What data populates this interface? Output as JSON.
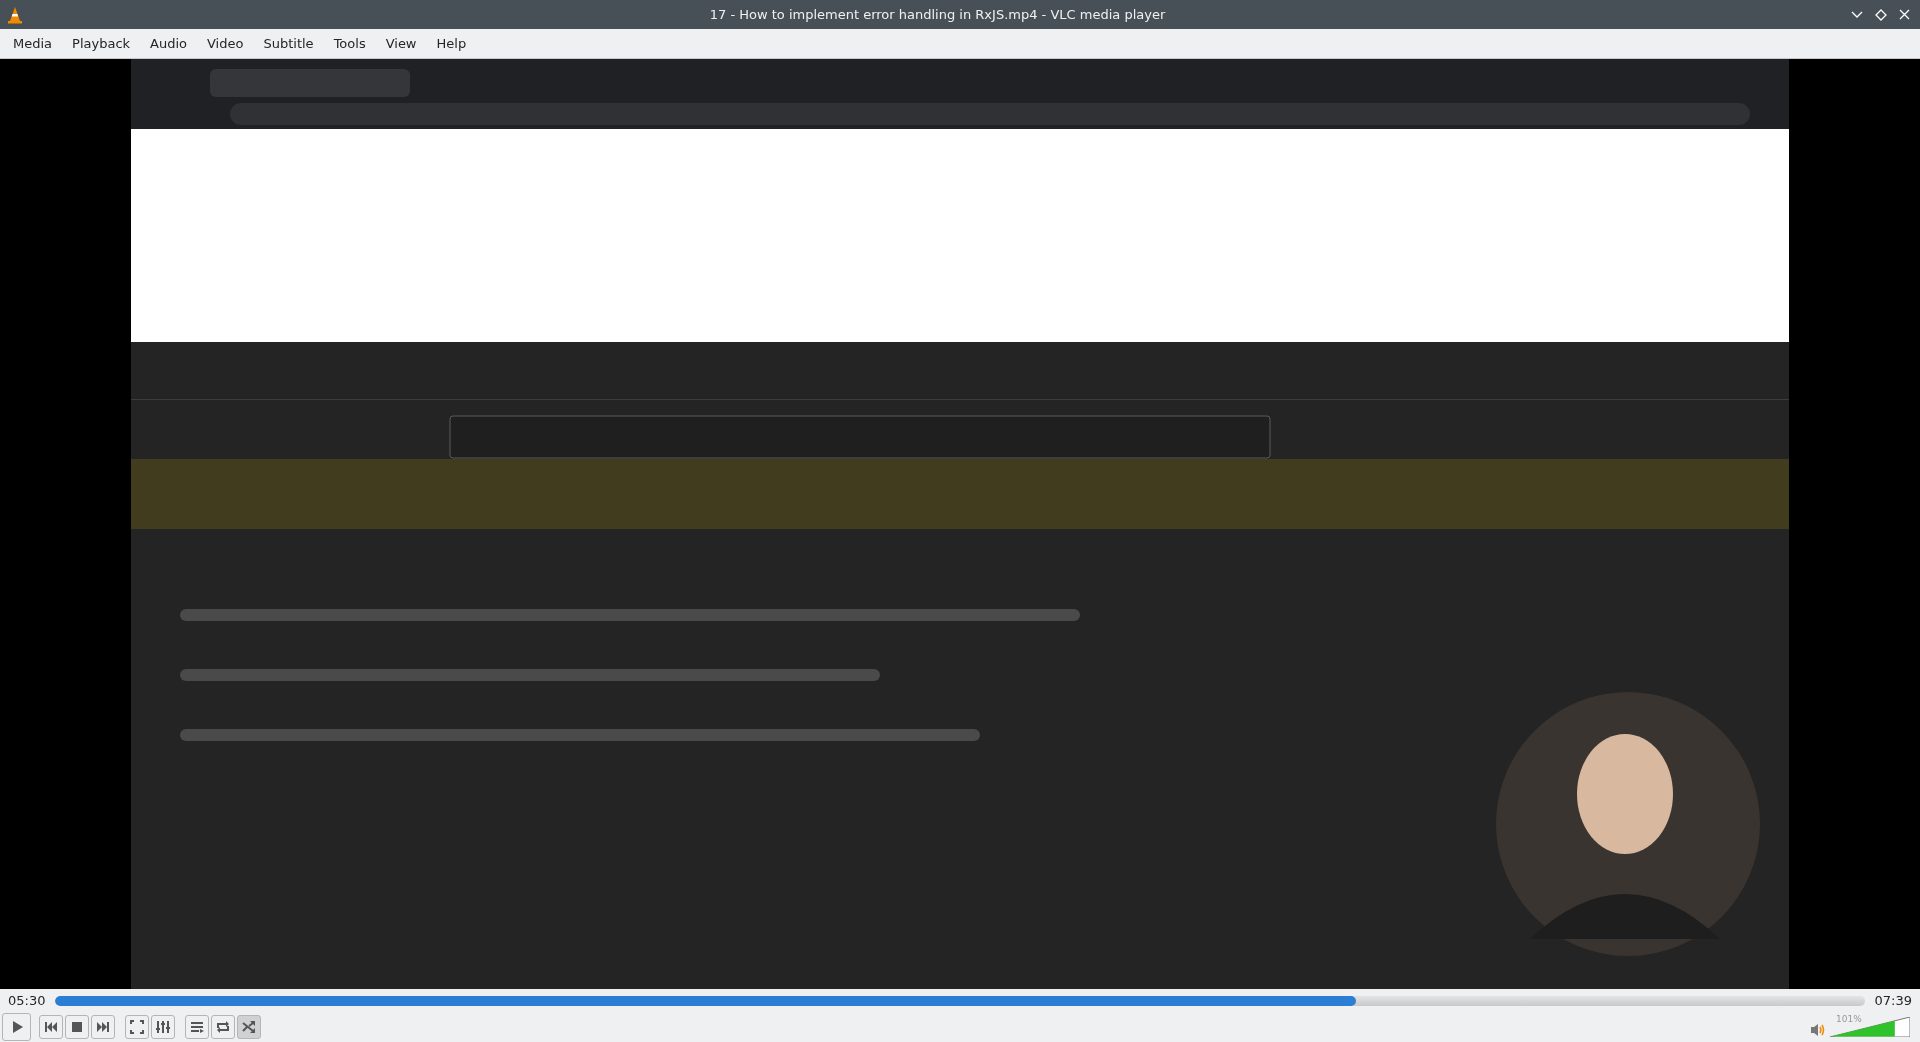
{
  "window": {
    "title": "17 - How to implement error handling in RxJS.mp4 - VLC media player"
  },
  "menu": [
    {
      "label": "Media"
    },
    {
      "label": "Playback"
    },
    {
      "label": "Audio"
    },
    {
      "label": "Video"
    },
    {
      "label": "Subtitle"
    },
    {
      "label": "Tools"
    },
    {
      "label": "View"
    },
    {
      "label": "Help"
    }
  ],
  "seek": {
    "elapsed": "05:30",
    "total": "07:39",
    "level": 0.719
  },
  "controls": [
    {
      "kind": "play"
    },
    {
      "kind": "prev"
    },
    {
      "kind": "stop"
    },
    {
      "kind": "next"
    },
    {
      "kind": "fullscreen"
    },
    {
      "kind": "extended"
    },
    {
      "kind": "playlist"
    },
    {
      "kind": "loop"
    },
    {
      "kind": "shuffle",
      "checked": true
    }
  ],
  "volume": {
    "reading": "101%",
    "level": 0.81
  }
}
